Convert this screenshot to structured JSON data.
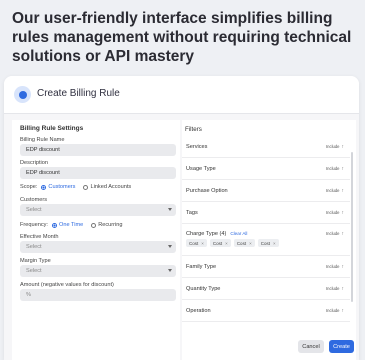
{
  "headline": "Our user-friendly interface simplifies billing rules management without requiring technical solutions or API mastery",
  "dialog": {
    "title": "Create Billing Rule"
  },
  "settings": {
    "section_title": "Billing Rule Settings",
    "rule_name_label": "Billing Rule Name",
    "rule_name_value": "EDP discount",
    "description_label": "Description",
    "description_value": "EDP discount",
    "scope_label": "Scope:",
    "scope_options": [
      "Customers",
      "Linked Accounts"
    ],
    "scope_selected": "Customers",
    "customers_label": "Customers",
    "customers_placeholder": "Select",
    "frequency_label": "Frequency:",
    "frequency_options": [
      "One Time",
      "Recurring"
    ],
    "frequency_selected": "One Time",
    "effective_month_label": "Effective Month",
    "effective_month_placeholder": "Select",
    "margin_type_label": "Margin Type",
    "margin_type_placeholder": "Select",
    "amount_label": "Amount (negative values for discount)",
    "amount_placeholder": "%"
  },
  "filters": {
    "title": "Filters",
    "include_label": "Include",
    "clear_all": "Clear All",
    "items": [
      {
        "name": "Services"
      },
      {
        "name": "Usage Type"
      },
      {
        "name": "Purchase Option"
      },
      {
        "name": "Tags"
      },
      {
        "name": "Charge Type (4)"
      },
      {
        "name": "Family Type"
      },
      {
        "name": "Quantity Type"
      },
      {
        "name": "Operation"
      }
    ],
    "charge_type_chips": [
      "Cost",
      "Cost",
      "Cost",
      "Cost"
    ]
  },
  "footer": {
    "cancel_label": "Cancel",
    "create_label": "Create"
  },
  "colors": {
    "accent": "#2e6ae0",
    "panel": "#ffffff",
    "background": "#eef0f4"
  }
}
